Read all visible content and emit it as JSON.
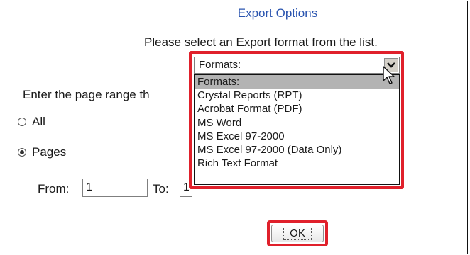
{
  "dialog": {
    "title": "Export Options",
    "instruction": "Please select an Export format from the list.",
    "page_range_label": "Enter the page range th"
  },
  "format_select": {
    "value": "Formats:",
    "options": [
      "Formats:",
      "Crystal Reports (RPT)",
      "Acrobat Format (PDF)",
      "MS Word",
      "MS Excel 97-2000",
      "MS Excel 97-2000 (Data Only)",
      "Rich Text Format"
    ],
    "highlighted_index": 0
  },
  "range": {
    "all_label": "All",
    "pages_label": "Pages",
    "selected": "Pages",
    "from_label": "From:",
    "from_value": "1",
    "to_label": "To:",
    "to_value": "1"
  },
  "buttons": {
    "ok_label": "OK"
  },
  "colors": {
    "title": "#2b55b0",
    "highlight": "#e0202b",
    "selected_option": "#b3b3b3"
  },
  "icons": {
    "select_arrow": "chevron-down-icon",
    "cursor": "mouse-pointer-icon"
  }
}
